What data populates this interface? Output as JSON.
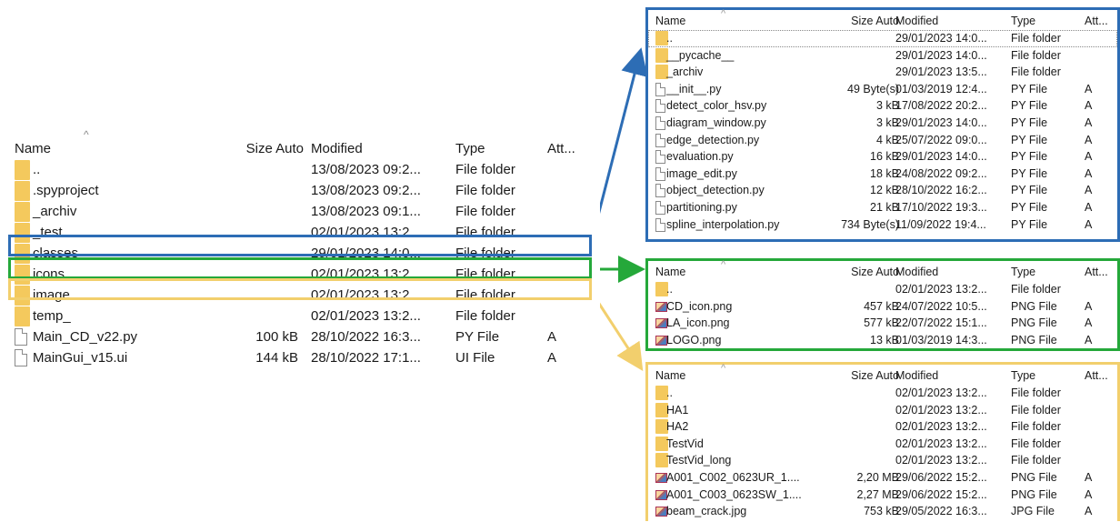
{
  "colors": {
    "blue": "#2d6db5",
    "green": "#25a83a",
    "yellow": "#f2cf6d",
    "folder": "#f4c95d"
  },
  "columns": {
    "name": "Name",
    "size": "Size Auto",
    "modified": "Modified",
    "type": "Type",
    "attr": "Att..."
  },
  "main_pane": {
    "rows": [
      {
        "icon": "folder-icon",
        "name": "..",
        "size": "",
        "modified": "13/08/2023 09:2...",
        "type": "File folder",
        "attr": ""
      },
      {
        "icon": "folder-icon",
        "name": ".spyproject",
        "size": "",
        "modified": "13/08/2023 09:2...",
        "type": "File folder",
        "attr": ""
      },
      {
        "icon": "folder-icon",
        "name": "_archiv",
        "size": "",
        "modified": "13/08/2023 09:1...",
        "type": "File folder",
        "attr": ""
      },
      {
        "icon": "folder-icon",
        "name": "_test",
        "size": "",
        "modified": "02/01/2023 13:2...",
        "type": "File folder",
        "attr": ""
      },
      {
        "icon": "folder-icon",
        "name": "classes",
        "size": "",
        "modified": "29/01/2023 14:0...",
        "type": "File folder",
        "attr": ""
      },
      {
        "icon": "folder-icon",
        "name": "icons",
        "size": "",
        "modified": "02/01/2023 13:2...",
        "type": "File folder",
        "attr": ""
      },
      {
        "icon": "folder-icon",
        "name": "image",
        "size": "",
        "modified": "02/01/2023 13:2...",
        "type": "File folder",
        "attr": ""
      },
      {
        "icon": "folder-icon",
        "name": "temp_",
        "size": "",
        "modified": "02/01/2023 13:2...",
        "type": "File folder",
        "attr": ""
      },
      {
        "icon": "file-icon",
        "name": "Main_CD_v22.py",
        "size": "100 kB",
        "modified": "28/10/2022 16:3...",
        "type": "PY File",
        "attr": "A"
      },
      {
        "icon": "file-icon",
        "name": "MainGui_v15.ui",
        "size": "144 kB",
        "modified": "28/10/2022 17:1...",
        "type": "UI File",
        "attr": "A"
      }
    ]
  },
  "classes_pane": {
    "rows": [
      {
        "icon": "folder-icon",
        "name": "..",
        "size": "",
        "modified": "29/01/2023 14:0...",
        "type": "File folder",
        "attr": ""
      },
      {
        "icon": "folder-icon",
        "name": "__pycache__",
        "size": "",
        "modified": "29/01/2023 14:0...",
        "type": "File folder",
        "attr": ""
      },
      {
        "icon": "folder-icon",
        "name": "_archiv",
        "size": "",
        "modified": "29/01/2023 13:5...",
        "type": "File folder",
        "attr": ""
      },
      {
        "icon": "file-icon",
        "name": "__init__.py",
        "size": "49 Byte(s)",
        "modified": "01/03/2019 12:4...",
        "type": "PY File",
        "attr": "A"
      },
      {
        "icon": "file-icon",
        "name": "detect_color_hsv.py",
        "size": "3 kB",
        "modified": "17/08/2022 20:2...",
        "type": "PY File",
        "attr": "A"
      },
      {
        "icon": "file-icon",
        "name": "diagram_window.py",
        "size": "3 kB",
        "modified": "29/01/2023 14:0...",
        "type": "PY File",
        "attr": "A"
      },
      {
        "icon": "file-icon",
        "name": "edge_detection.py",
        "size": "4 kB",
        "modified": "25/07/2022 09:0...",
        "type": "PY File",
        "attr": "A"
      },
      {
        "icon": "file-icon",
        "name": "evaluation.py",
        "size": "16 kB",
        "modified": "29/01/2023 14:0...",
        "type": "PY File",
        "attr": "A"
      },
      {
        "icon": "file-icon",
        "name": "image_edit.py",
        "size": "18 kB",
        "modified": "24/08/2022 09:2...",
        "type": "PY File",
        "attr": "A"
      },
      {
        "icon": "file-icon",
        "name": "object_detection.py",
        "size": "12 kB",
        "modified": "28/10/2022 16:2...",
        "type": "PY File",
        "attr": "A"
      },
      {
        "icon": "file-icon",
        "name": "partitioning.py",
        "size": "21 kB",
        "modified": "17/10/2022 19:3...",
        "type": "PY File",
        "attr": "A"
      },
      {
        "icon": "file-icon",
        "name": "spline_interpolation.py",
        "size": "734 Byte(s)",
        "modified": "11/09/2022 19:4...",
        "type": "PY File",
        "attr": "A"
      }
    ]
  },
  "icons_pane": {
    "rows": [
      {
        "icon": "folder-icon",
        "name": "..",
        "size": "",
        "modified": "02/01/2023 13:2...",
        "type": "File folder",
        "attr": ""
      },
      {
        "icon": "image-file-icon",
        "name": "CD_icon.png",
        "size": "457 kB",
        "modified": "24/07/2022 10:5...",
        "type": "PNG File",
        "attr": "A"
      },
      {
        "icon": "image-file-icon",
        "name": "LA_icon.png",
        "size": "577 kB",
        "modified": "22/07/2022 15:1...",
        "type": "PNG File",
        "attr": "A"
      },
      {
        "icon": "image-file-icon",
        "name": "LOGO.png",
        "size": "13 kB",
        "modified": "01/03/2019 14:3...",
        "type": "PNG File",
        "attr": "A"
      }
    ]
  },
  "image_pane": {
    "rows": [
      {
        "icon": "folder-icon",
        "name": "..",
        "size": "",
        "modified": "02/01/2023 13:2...",
        "type": "File folder",
        "attr": ""
      },
      {
        "icon": "folder-icon",
        "name": "HA1",
        "size": "",
        "modified": "02/01/2023 13:2...",
        "type": "File folder",
        "attr": ""
      },
      {
        "icon": "folder-icon",
        "name": "HA2",
        "size": "",
        "modified": "02/01/2023 13:2...",
        "type": "File folder",
        "attr": ""
      },
      {
        "icon": "folder-icon",
        "name": "TestVid",
        "size": "",
        "modified": "02/01/2023 13:2...",
        "type": "File folder",
        "attr": ""
      },
      {
        "icon": "folder-icon",
        "name": "TestVid_long",
        "size": "",
        "modified": "02/01/2023 13:2...",
        "type": "File folder",
        "attr": ""
      },
      {
        "icon": "image-file-icon",
        "name": "A001_C002_0623UR_1....",
        "size": "2,20 MB",
        "modified": "29/06/2022 15:2...",
        "type": "PNG File",
        "attr": "A"
      },
      {
        "icon": "image-file-icon",
        "name": "A001_C003_0623SW_1....",
        "size": "2,27 MB",
        "modified": "29/06/2022 15:2...",
        "type": "PNG File",
        "attr": "A"
      },
      {
        "icon": "image-file-icon",
        "name": "beam_crack.jpg",
        "size": "753 kB",
        "modified": "29/05/2022 16:3...",
        "type": "JPG File",
        "attr": "A"
      }
    ]
  }
}
